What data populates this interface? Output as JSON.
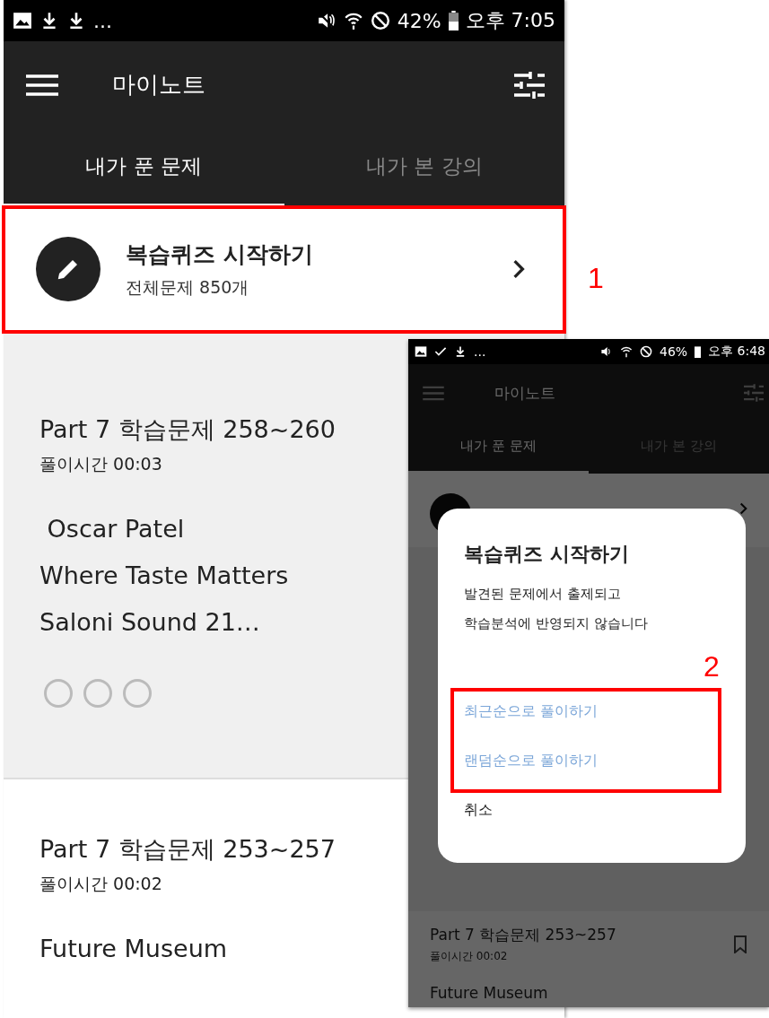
{
  "main_screen": {
    "status_bar": {
      "more": "...",
      "battery": "42%",
      "time": "오후 7:05"
    },
    "app_bar": {
      "title": "마이노트"
    },
    "tabs": [
      {
        "label": "내가 푼 문제",
        "selected": true
      },
      {
        "label": "내가 본 강의",
        "selected": false
      }
    ],
    "quiz_row": {
      "title": "복습퀴즈 시작하기",
      "subtitle": "전체문제 850개"
    },
    "cards": [
      {
        "title": "Part 7 학습문제 258~260",
        "time": "풀이시간 00:03",
        "lines": [
          " Oscar Patel",
          "Where Taste Matters",
          "Saloni Sound 21…"
        ],
        "marks": [
          {
            "filled": false
          },
          {
            "filled": false
          },
          {
            "filled": false
          }
        ],
        "selected": true
      },
      {
        "title": "Part 7 학습문제 253~257",
        "time": "풀이시간 00:02",
        "lines": [
          "Future Museum"
        ],
        "selected": false
      }
    ]
  },
  "inset_screen": {
    "status_bar": {
      "more": "...",
      "battery": "46%",
      "time": "오후 6:48"
    },
    "app_bar": {
      "title": "마이노트"
    },
    "tabs": [
      {
        "label": "내가 푼 문제",
        "selected": true
      },
      {
        "label": "내가 본 강의",
        "selected": false
      }
    ],
    "card": {
      "title": "Part 7 학습문제 253~257",
      "time": "풀이시간 00:02",
      "line": "Future Museum"
    },
    "dialog": {
      "title": "복습퀴즈 시작하기",
      "message_lines": [
        "발견된 문제에서 출제되고",
        "학습분석에 반영되지 않습니다"
      ],
      "options": [
        {
          "label": "최근순으로 풀이하기",
          "kind": "primary"
        },
        {
          "label": "랜덤순으로 풀이하기",
          "kind": "primary"
        },
        {
          "label": "취소",
          "kind": "cancel"
        }
      ]
    }
  },
  "annotations": [
    {
      "label": "1"
    },
    {
      "label": "2"
    }
  ]
}
